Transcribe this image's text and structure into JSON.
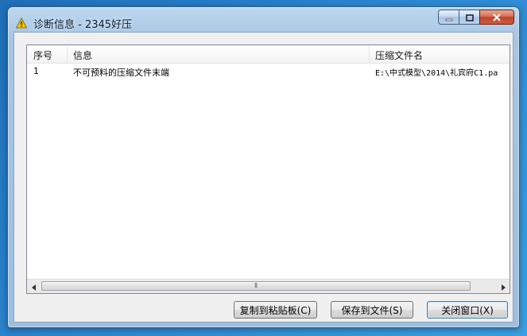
{
  "window": {
    "title": "诊断信息 - 2345好压"
  },
  "icons": {
    "title_icon": "warning-icon",
    "minimize": "minimize-icon",
    "maximize": "maximize-icon",
    "close": "close-icon"
  },
  "list": {
    "columns": [
      "序号",
      "信息",
      "压缩文件名"
    ],
    "rows": [
      {
        "index": "1",
        "info": "不可预料的压缩文件末端",
        "archive": "E:\\中式模型\\2014\\礼宾府C1.pa"
      }
    ]
  },
  "scrollbar": {
    "grip": "⦀"
  },
  "buttons": {
    "copy": "复制到粘贴板(C)",
    "save": "保存到文件(S)",
    "close": "关闭窗口(X)"
  },
  "colors": {
    "desktop": "#2b86d0",
    "frame": "#a7c6e3",
    "close_button": "#c2432a"
  }
}
